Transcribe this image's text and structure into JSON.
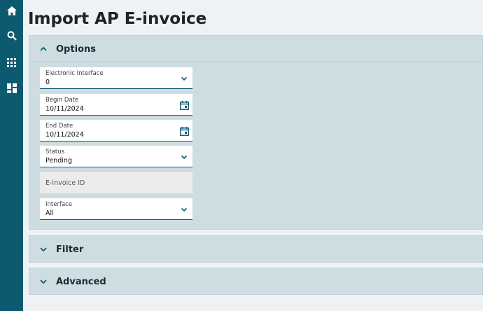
{
  "sidebar": {
    "items": [
      {
        "icon": "home-icon"
      },
      {
        "icon": "search-icon"
      },
      {
        "icon": "apps-grid-icon"
      },
      {
        "icon": "dashboard-icon"
      }
    ]
  },
  "page": {
    "title": "Import AP E-invoice"
  },
  "sections": {
    "options": {
      "title": "Options",
      "fields": {
        "electronic_interface": {
          "label": "Electronic Interface",
          "value": "0"
        },
        "begin_date": {
          "label": "Begin Date",
          "value": "10/11/2024"
        },
        "end_date": {
          "label": "End Date",
          "value": "10/11/2024"
        },
        "status": {
          "label": "Status",
          "value": "Pending"
        },
        "einvoice_id": {
          "placeholder": "E-invoice ID"
        },
        "interface": {
          "label": "Interface",
          "value": "All"
        }
      }
    },
    "filter": {
      "title": "Filter"
    },
    "advanced": {
      "title": "Advanced"
    }
  },
  "colors": {
    "sidebar": "#0c5a70",
    "panel": "#cddde2",
    "accent": "#0c5a70"
  }
}
